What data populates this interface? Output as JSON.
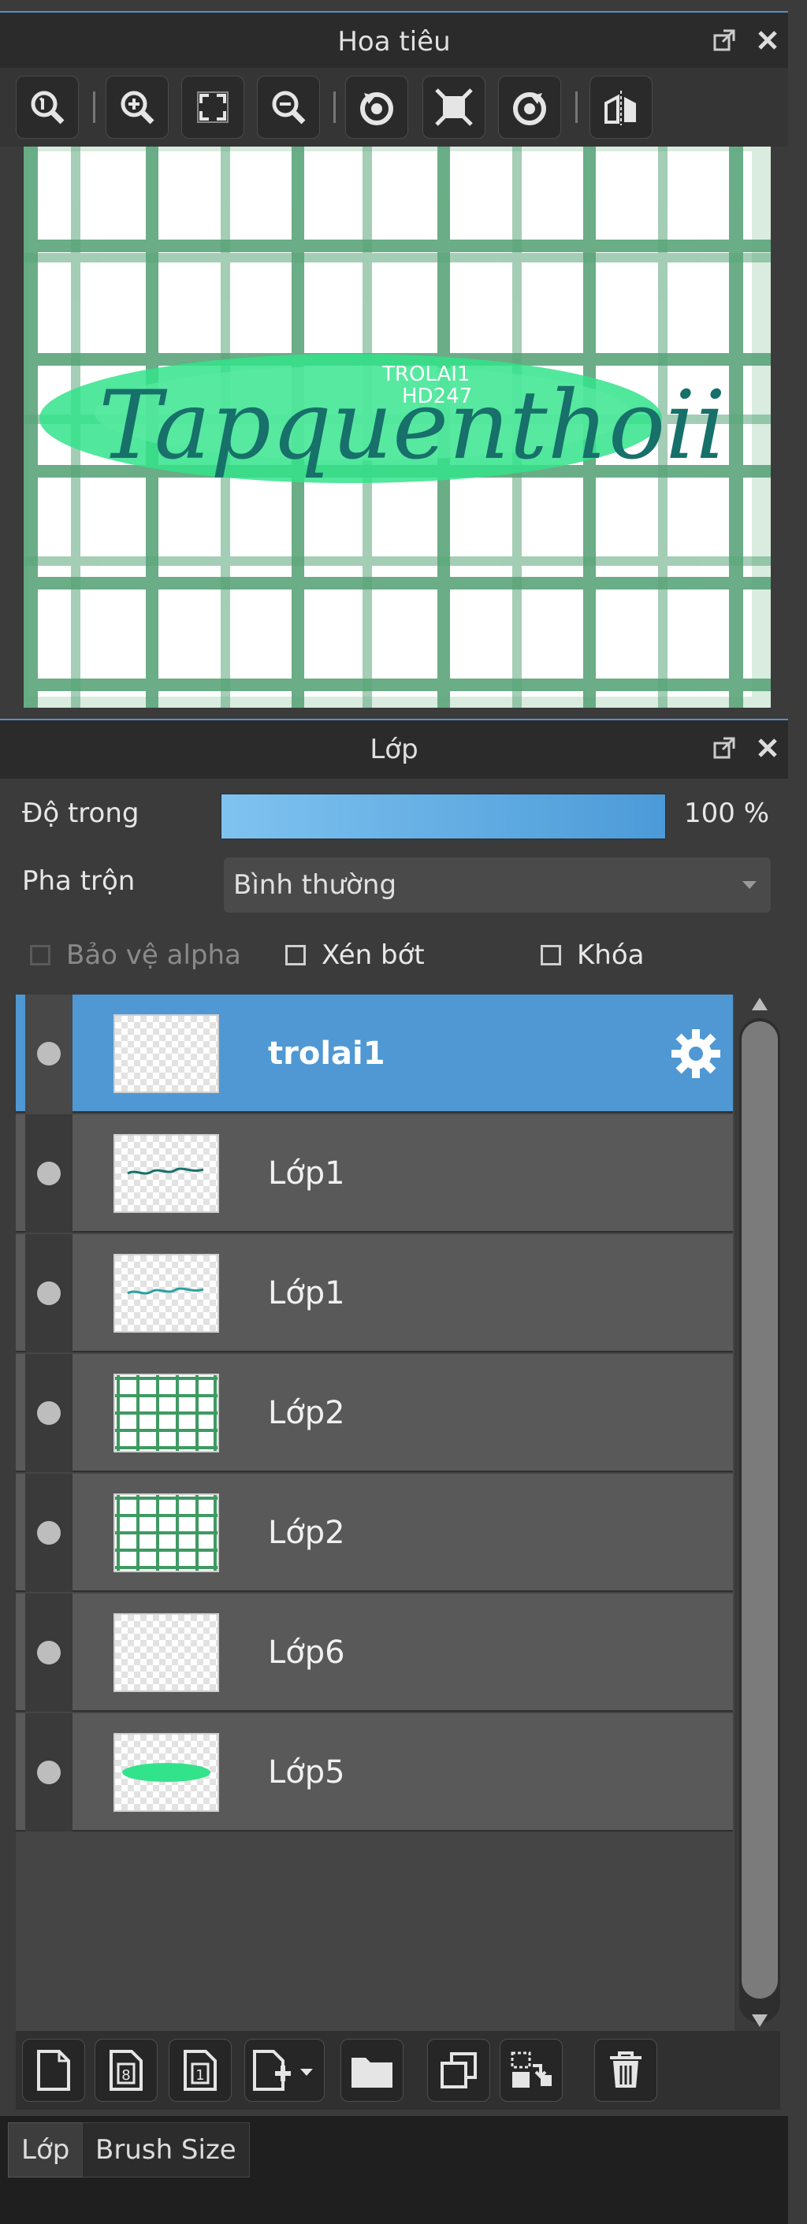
{
  "navigator": {
    "title": "Hoa tiêu",
    "toolbar": [
      "zoom-actual-icon",
      "zoom-in-icon",
      "fit-screen-icon",
      "zoom-out-icon",
      "rotate-left-icon",
      "fullscreen-icon",
      "rotate-right-icon",
      "flip-icon"
    ],
    "preview_text": {
      "script": "Tapquenthoii",
      "tag1": "TROLAI1",
      "tag2": "HD247"
    }
  },
  "layers_panel": {
    "title": "Lớp",
    "opacity_label": "Độ trong",
    "opacity_value": "100 %",
    "opacity": 1.0,
    "blend_label": "Pha trộn",
    "blend_value": "Bình thường",
    "protect_alpha": "Bảo vệ alpha",
    "clipping": "Xén bớt",
    "lock": "Khóa",
    "layers": [
      {
        "name": "trolai1",
        "thumb": "blank",
        "active": true
      },
      {
        "name": "Lớp1",
        "thumb": "text"
      },
      {
        "name": "Lớp1",
        "thumb": "text"
      },
      {
        "name": "Lớp2",
        "thumb": "grid"
      },
      {
        "name": "Lớp2",
        "thumb": "grid"
      },
      {
        "name": "Lớp6",
        "thumb": "blank"
      },
      {
        "name": "Lớp5",
        "thumb": "green"
      }
    ],
    "bottom_toolbar": [
      "new-layer-icon",
      "new-8bit-layer-icon",
      "new-1bit-layer-icon",
      "add-layer-menu-icon",
      "folder-icon",
      "duplicate-icon",
      "merge-down-icon",
      "delete-icon"
    ]
  },
  "tabs": {
    "layers": "Lớp",
    "brush_size": "Brush Size"
  },
  "colors": {
    "accent": "#4f98d3",
    "grid_green": "#5aa57a",
    "brush_green": "#33e38b",
    "text_teal": "#17706a"
  }
}
